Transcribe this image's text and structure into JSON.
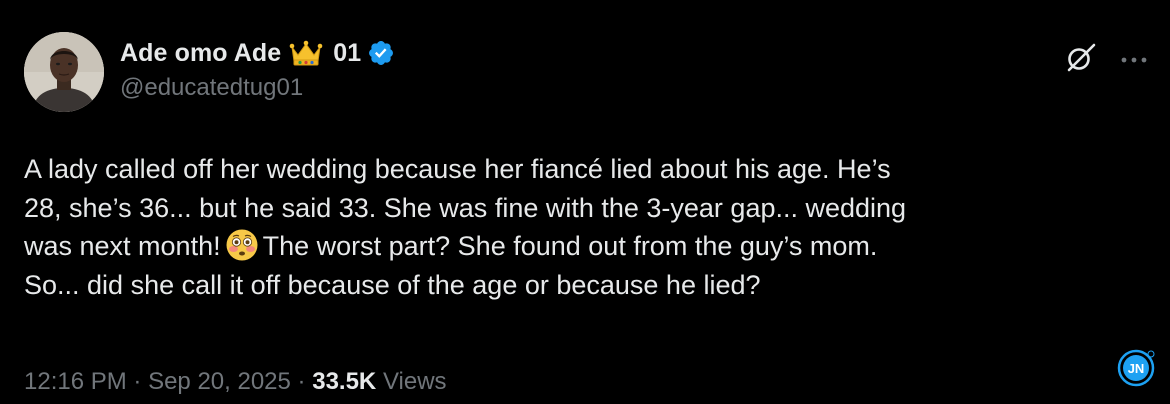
{
  "tweet": {
    "author": {
      "display_name": "Ade omo Ade",
      "emoji": "crown",
      "name_suffix": "01",
      "verified": true,
      "handle": "@educatedtug01"
    },
    "icons": {
      "grok": "grok-icon",
      "more": "more-icon"
    },
    "text_lines": [
      "A lady called off her wedding because her fiancé lied about his age. He’s",
      "28, she’s 36... but he said 33. She was fine with the 3-year gap... wedding",
      "was next month!",
      "The worst part? She found out from the guy’s mom.",
      "So... did she call it off because of the age or because he lied?"
    ],
    "inline_emoji": "flushed-face",
    "meta": {
      "time": "12:16 PM",
      "separator": "·",
      "date": "Sep 20, 2025",
      "views_count": "33.5K",
      "views_label": "Views"
    },
    "watermark": {
      "text": "JN",
      "color": "#1da1f2"
    }
  },
  "colors": {
    "background": "#000000",
    "primary_text": "#e7e9ea",
    "secondary_text": "#71767b",
    "verified_badge": "#1d9bf0"
  }
}
